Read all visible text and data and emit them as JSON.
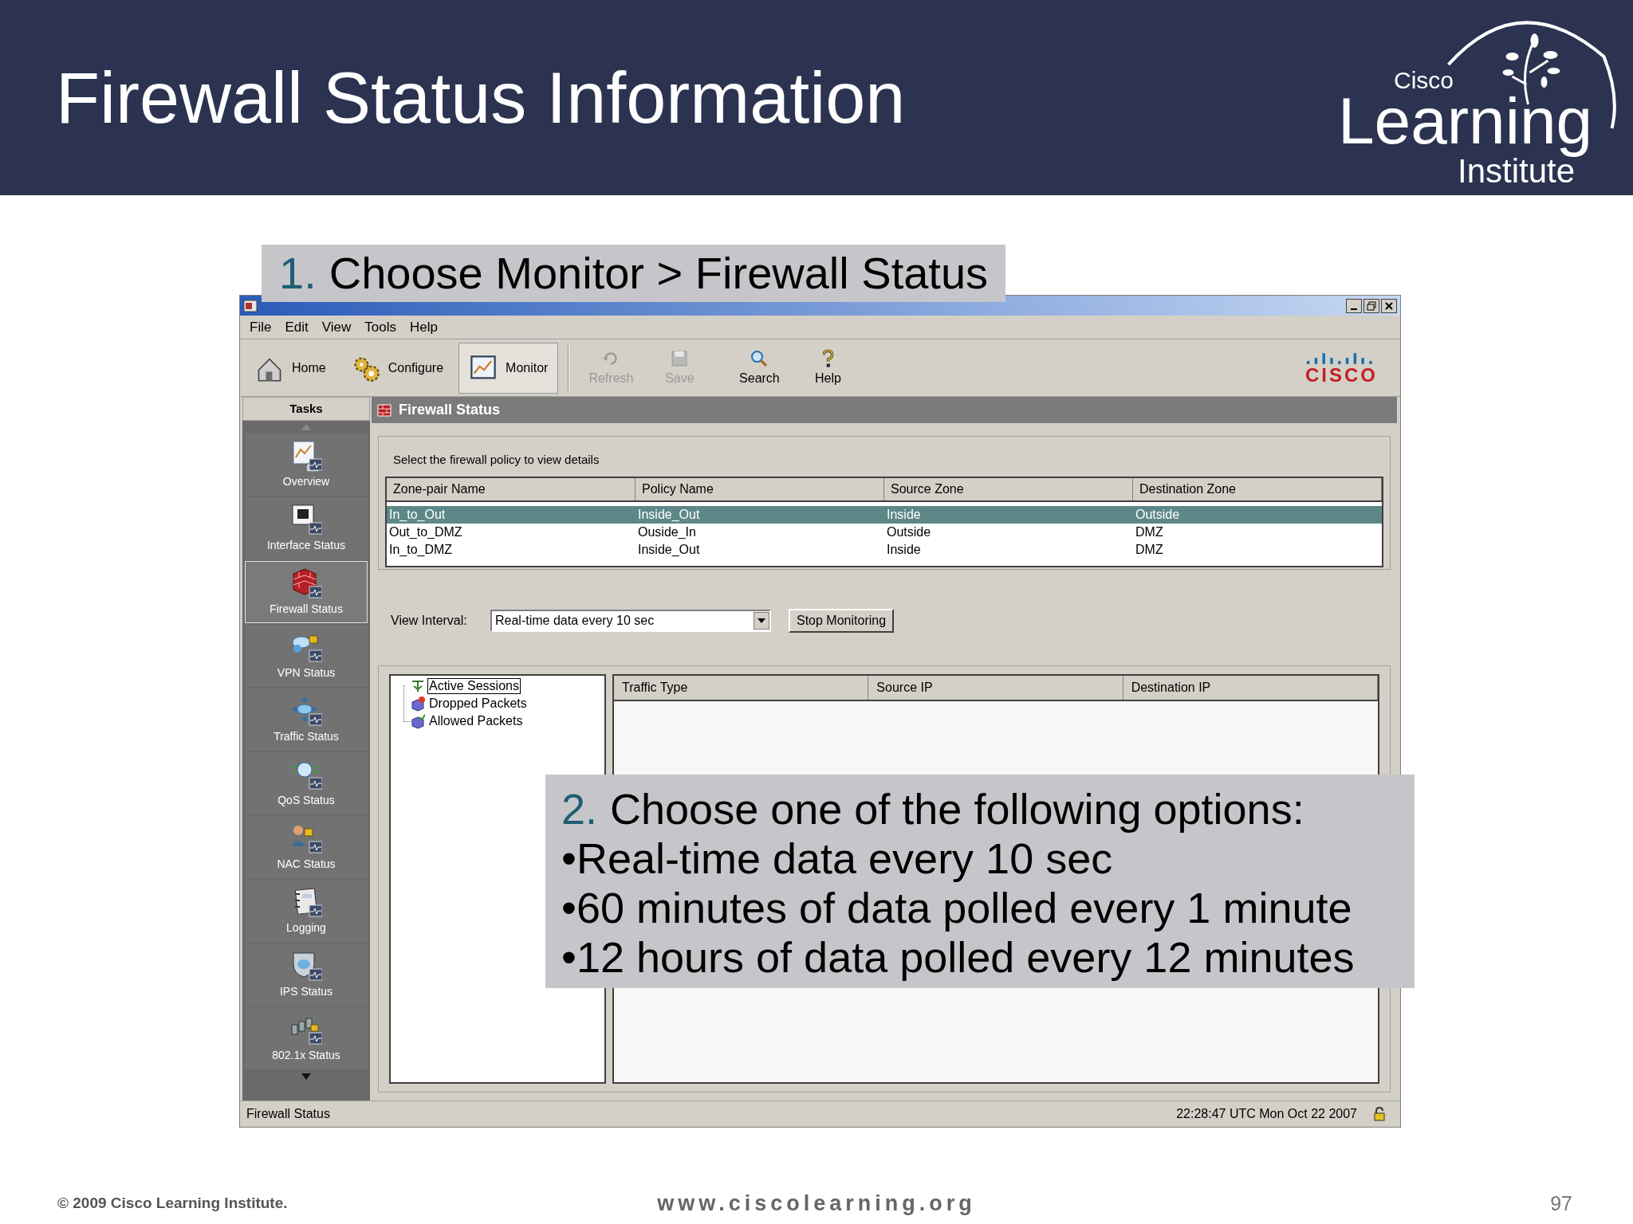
{
  "slide": {
    "title": "Firewall Status Information",
    "logo": {
      "small": "Cisco",
      "large": "Learning",
      "sub": "Institute"
    },
    "footer": {
      "copyright": "© 2009 Cisco Learning Institute.",
      "url": "www.ciscolearning.org",
      "page": "97"
    }
  },
  "callouts": [
    {
      "number": "1.",
      "text": "Choose Monitor > Firewall Status"
    },
    {
      "number": "2.",
      "text": "Choose one of the following options:",
      "bullets": [
        "•Real-time data every 10 sec",
        "•60 minutes of data polled every 1 minute",
        "•12 hours of data polled every 12 minutes"
      ]
    }
  ],
  "window": {
    "menu": [
      "File",
      "Edit",
      "View",
      "Tools",
      "Help"
    ],
    "toolbar": [
      {
        "label": "Home",
        "kind": "wide",
        "selected": false,
        "disabled": false
      },
      {
        "label": "Configure",
        "kind": "wide",
        "selected": false,
        "disabled": false
      },
      {
        "label": "Monitor",
        "kind": "wide",
        "selected": true,
        "disabled": false
      },
      {
        "label": "Refresh",
        "kind": "small",
        "selected": false,
        "disabled": true
      },
      {
        "label": "Save",
        "kind": "small",
        "selected": false,
        "disabled": true
      },
      {
        "label": "Search",
        "kind": "small",
        "selected": false,
        "disabled": false
      },
      {
        "label": "Help",
        "kind": "small",
        "selected": false,
        "disabled": false
      }
    ],
    "brand": "CISCO",
    "tasks_header": "Tasks",
    "tasks": [
      {
        "label": "Overview",
        "selected": false
      },
      {
        "label": "Interface Status",
        "selected": false
      },
      {
        "label": "Firewall Status",
        "selected": true
      },
      {
        "label": "VPN Status",
        "selected": false
      },
      {
        "label": "Traffic Status",
        "selected": false
      },
      {
        "label": "QoS Status",
        "selected": false
      },
      {
        "label": "NAC Status",
        "selected": false
      },
      {
        "label": "Logging",
        "selected": false
      },
      {
        "label": "IPS Status",
        "selected": false
      },
      {
        "label": "802.1x Status",
        "selected": false
      }
    ],
    "panel_title": "Firewall Status",
    "instruction": "Select the firewall policy to view details",
    "policy_table": {
      "columns": [
        "Zone-pair Name",
        "Policy Name",
        "Source Zone",
        "Destination Zone"
      ],
      "rows": [
        {
          "cells": [
            "In_to_Out",
            "Inside_Out",
            "Inside",
            "Outside"
          ],
          "selected": true
        },
        {
          "cells": [
            "Out_to_DMZ",
            "Ouside_In",
            "Outside",
            "DMZ"
          ],
          "selected": false
        },
        {
          "cells": [
            "In_to_DMZ",
            "Inside_Out",
            "Inside",
            "DMZ"
          ],
          "selected": false
        }
      ]
    },
    "view_interval": {
      "label": "View Interval:",
      "value": "Real-time data every 10 sec"
    },
    "stop_button": "Stop Monitoring",
    "tree": [
      {
        "label": "Active Sessions",
        "selected": true
      },
      {
        "label": "Dropped Packets",
        "selected": false
      },
      {
        "label": "Allowed Packets",
        "selected": false
      }
    ],
    "detail_table": {
      "columns": [
        "Traffic Type",
        "Source IP",
        "Destination IP"
      ]
    },
    "status_bar": {
      "left": "Firewall Status",
      "time": "22:28:47 UTC Mon Oct 22 2007"
    }
  }
}
